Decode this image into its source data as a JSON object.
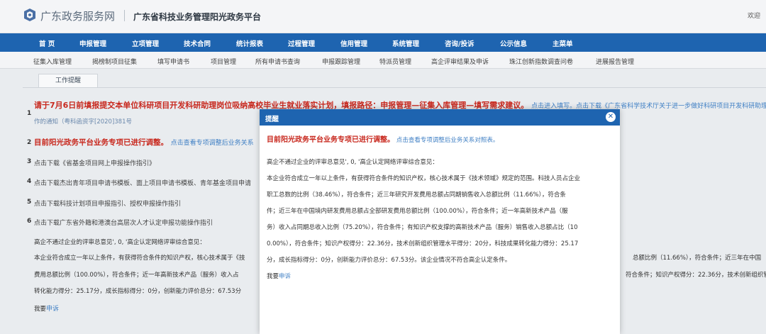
{
  "header": {
    "portal_name": "广东政务服务网",
    "site_title": "广东省科技业务管理阳光政务平台",
    "welcome": "欢迎"
  },
  "main_nav": [
    "首 页",
    "申报管理",
    "立项管理",
    "技术合同",
    "统计报表",
    "过程管理",
    "信用管理",
    "系统管理",
    "咨询/投诉",
    "公示信息",
    "主菜单"
  ],
  "sub_nav": [
    "征集入库管理",
    "揭榜制项目征集",
    "填写申请书",
    "项目管理",
    "所有申请书查询",
    "申报跟踪管理",
    "特派员管理",
    "高企评审结果及申诉",
    "珠江创新指数调查问卷",
    "进展报告管理"
  ],
  "tab": {
    "label": "工作提醒"
  },
  "notices": [
    {
      "num": "1",
      "title": "请于7月6日前填报提交本单位科研项目开发科研助理岗位吸纳高校毕业生就业落实计划，填报路径：申报管理—征集入库管理—填写需求建议。",
      "link_text": "点击进入填写。点击下载《广东省科学技术厅关于进一步做好科研项目开发科研助理岗位",
      "sub_text": "作的通知（粤科函资字[2020]381号"
    },
    {
      "num": "2",
      "title": "目前阳光政务平台业务专项已进行调整。",
      "link_text": "点击查看专项调整后业务关系"
    },
    {
      "num": "3",
      "text": "点击下载《省基金项目网上申报操作指引》"
    },
    {
      "num": "4",
      "text": "点击下载杰出青年项目申请书模板、面上项目申请书模板、青年基金项目申请"
    },
    {
      "num": "5",
      "text": "点击下载科技计划项目申报指引、授权申报操作指引"
    },
    {
      "num": "6",
      "text": "点击下载广东省外籍和港澳台高层次人才认定申报功能操作指引"
    }
  ],
  "background_eval": {
    "line1": "高企不通过企业的评审总意见', 0, '高企认定网络评审综合意见：",
    "line2": "本企业符合成立一年以上条件，有获得符合条件的知识产权，核心技术属于《技",
    "line2b": "总额比例（11.66%），符合条件；近三年在中国",
    "line3": "费用总额比例（100.00%），符合条件；近一年高新技术产品（服务）收入占",
    "line3b": "符合条件；知识产权得分：22.36分，技术创新组织管",
    "line4": "转化能力得分：25.17分，成长指标得分：0分，创新能力评价总分：67.53分",
    "appeal_prefix": "我要",
    "appeal_link": "申诉"
  },
  "modal": {
    "title": "提醒",
    "notice_red": "目前阳光政务平台业务专项已进行调整。",
    "notice_link": "点击查看专项调整后业务关系对照表。",
    "eval_title": "高企不通过企业的评审总意见', 0, '高企认定网络评审综合意见：",
    "eval_lines": [
      "本企业符合成立一年以上条件，有获得符合条件的知识产权，核心技术属于《技术领域》规定的范围。科技人员占企业",
      "职工总数的比例（38.46%），符合条件；近三年研究开发费用总额占同期销售收入总额比例（11.66%），符合条",
      "件；近三年在中国境内研发费用总额占全部研发费用总额比例（100.00%），符合条件；近一年高新技术产品（服",
      "务）收入占同期总收入比例（75.20%），符合条件；有知识产权支撑的高新技术产品（服务）销售收入总额占比（10",
      "0.00%），符合条件；知识产权得分：22.36分，技术创新组织管理水平得分：20分，科技成果转化能力得分：25.17",
      "分，成长指标得分：0分，创新能力评价总分：67.53分。该企业情况不符合高企认定条件。"
    ],
    "appeal_prefix": "我要",
    "appeal_link": "申诉"
  },
  "colors": {
    "nav_blue": "#1e64b0",
    "alert_red": "#c8281e",
    "link_blue": "#3f7fc4"
  }
}
